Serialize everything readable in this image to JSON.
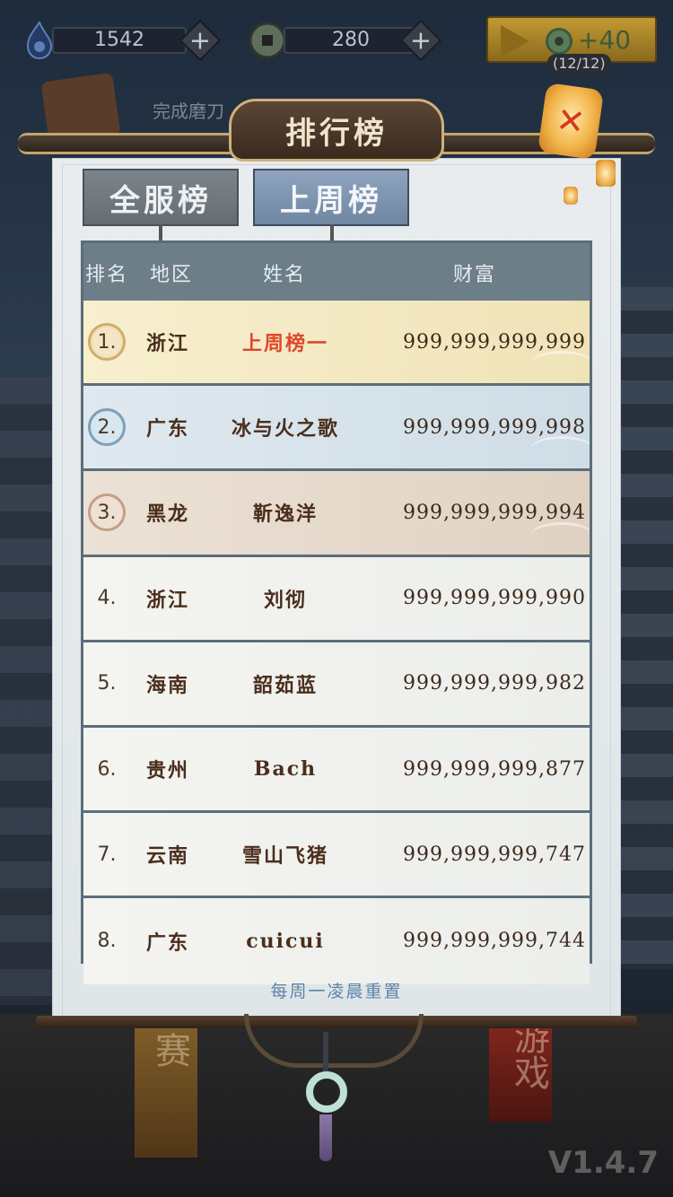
{
  "resources": {
    "stamina": {
      "icon": "flame-icon",
      "value": "1542"
    },
    "coins": {
      "icon": "coin-icon",
      "value": "280"
    },
    "video_reward": {
      "icon": "play-icon",
      "amount": "+40",
      "count": "(12/12)"
    }
  },
  "background": {
    "quest_text": "完成磨刀",
    "banner_left": "赛",
    "banner_right": "游戏",
    "version": "V1.4.7"
  },
  "panel": {
    "title": "排行榜",
    "close_icon": "close-icon",
    "tabs": [
      {
        "label": "全服榜",
        "active": false
      },
      {
        "label": "上周榜",
        "active": true
      }
    ],
    "columns": {
      "rank": "排名",
      "region": "地区",
      "name": "姓名",
      "wealth": "财富"
    },
    "rows": [
      {
        "rank": "1.",
        "region": "浙江",
        "name": "上周榜一",
        "wealth": "999,999,999,999"
      },
      {
        "rank": "2.",
        "region": "广东",
        "name": "冰与火之歌",
        "wealth": "999,999,999,998"
      },
      {
        "rank": "3.",
        "region": "黑龙",
        "name": "靳逸洋",
        "wealth": "999,999,999,994"
      },
      {
        "rank": "4.",
        "region": "浙江",
        "name": "刘彻",
        "wealth": "999,999,999,990"
      },
      {
        "rank": "5.",
        "region": "海南",
        "name": "韶茹蓝",
        "wealth": "999,999,999,982"
      },
      {
        "rank": "6.",
        "region": "贵州",
        "name": "Bach",
        "wealth": "999,999,999,877"
      },
      {
        "rank": "7.",
        "region": "云南",
        "name": "雪山飞猪",
        "wealth": "999,999,999,747"
      },
      {
        "rank": "8.",
        "region": "广东",
        "name": "cuicui",
        "wealth": "999,999,999,744"
      }
    ],
    "footer": "每周一凌晨重置"
  },
  "colors": {
    "highlight_name": "#e0472a",
    "tab_active": "#7f95b0",
    "tab_inactive": "#737b82"
  }
}
